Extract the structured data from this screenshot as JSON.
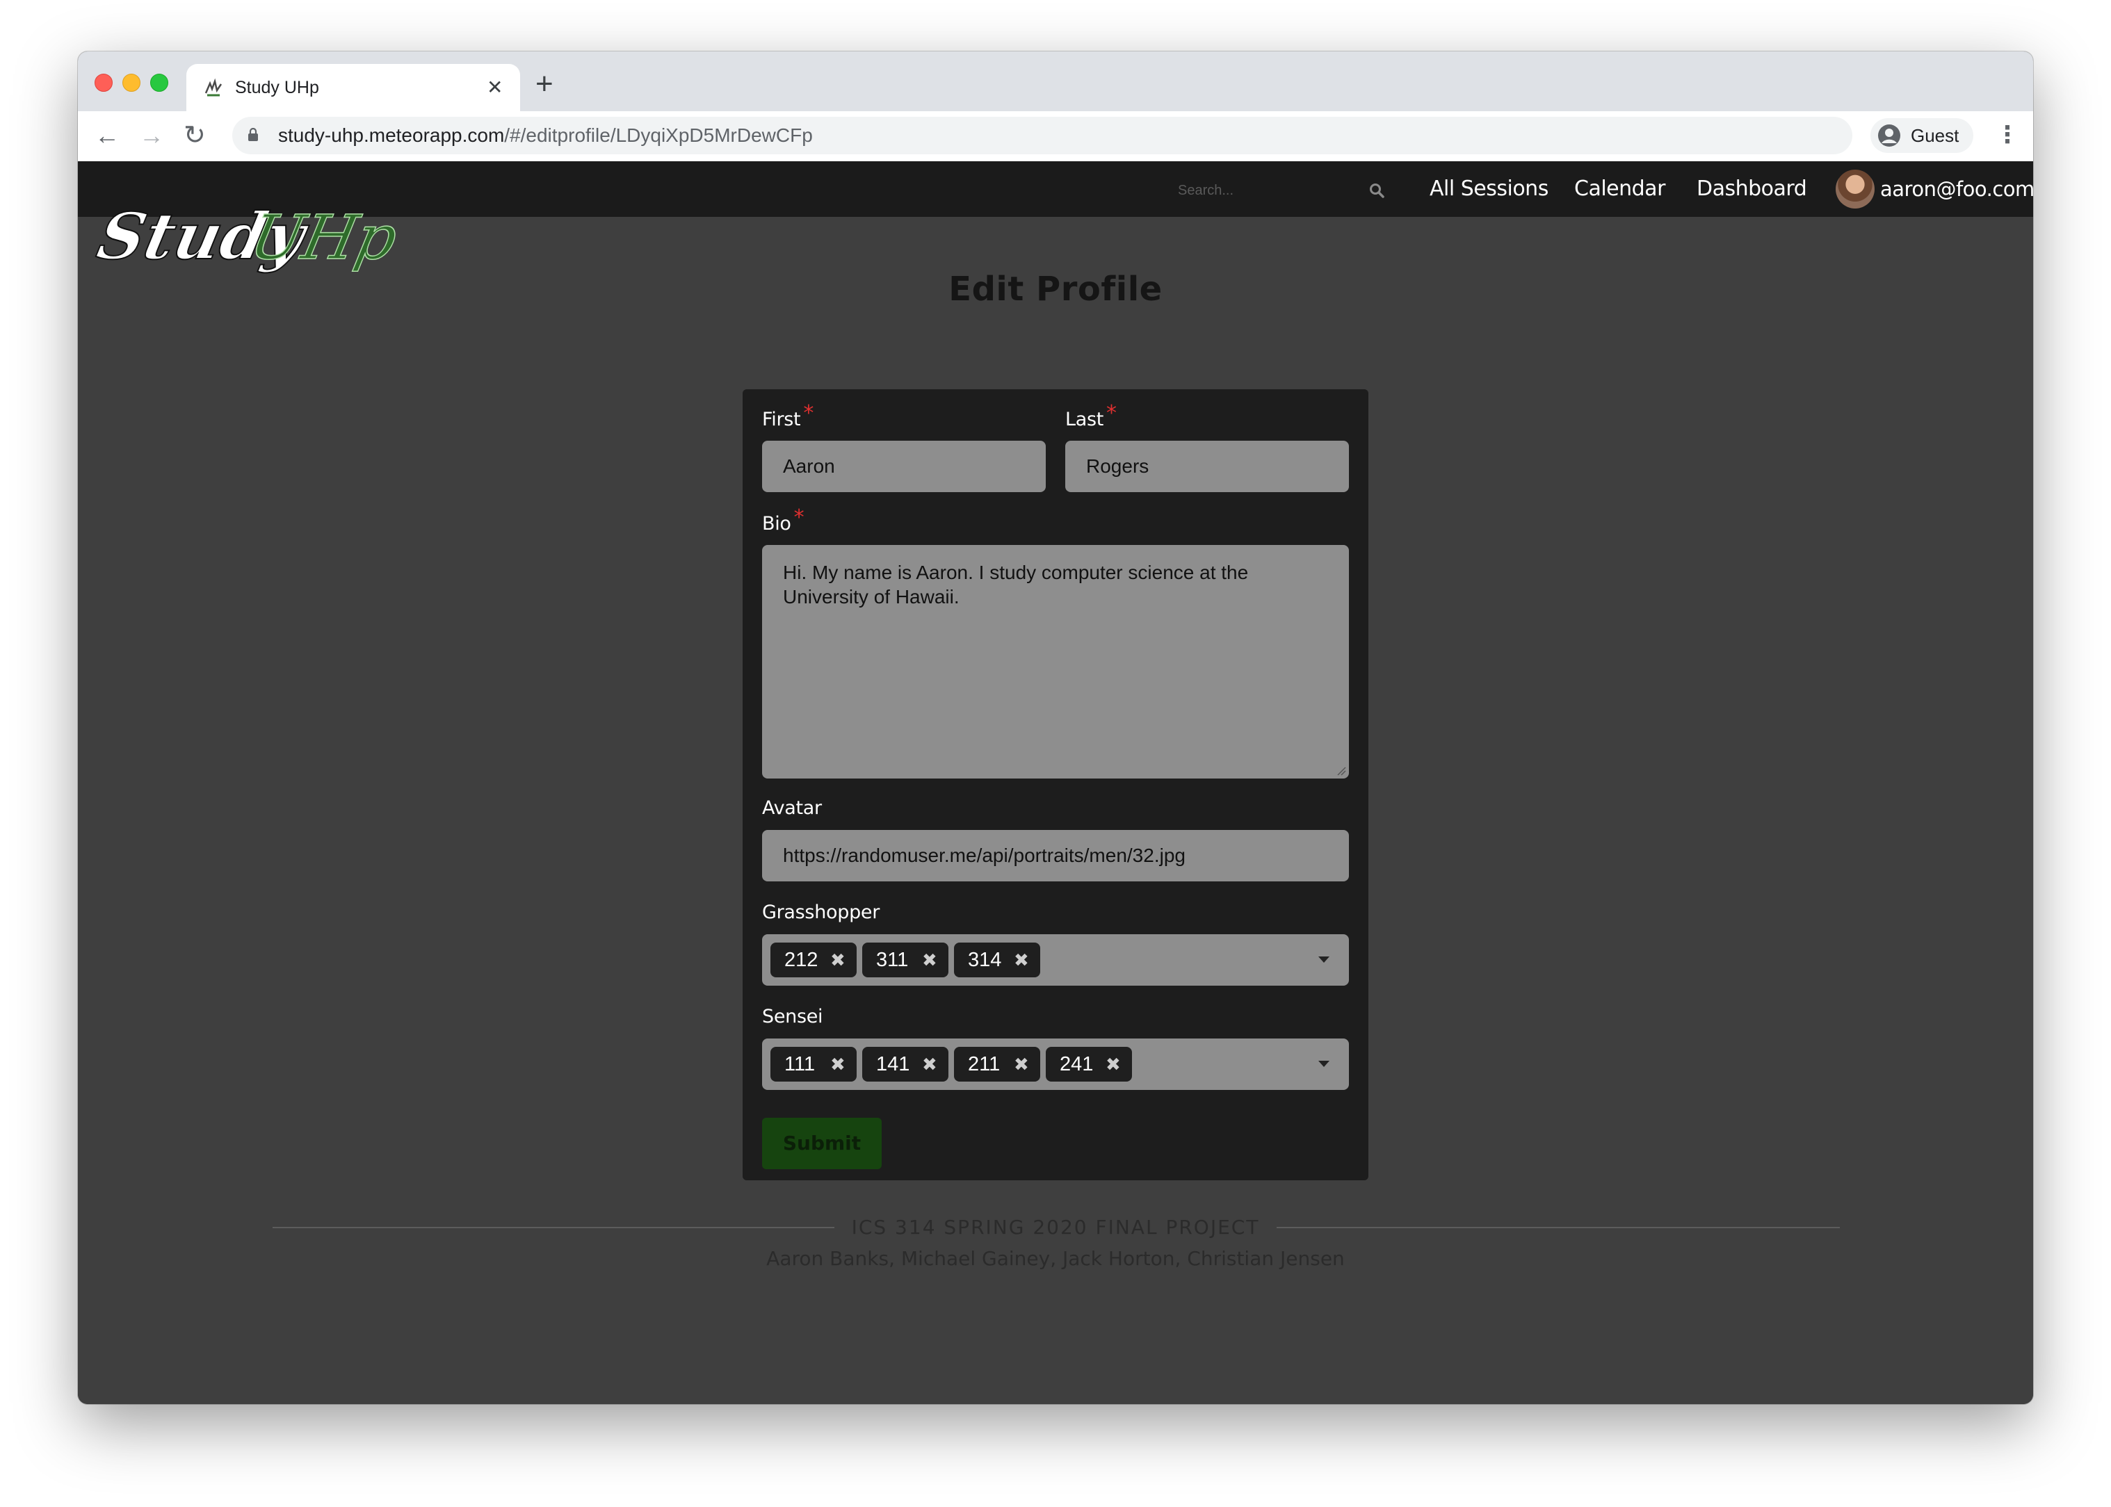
{
  "browser": {
    "tab_title": "Study UHp",
    "url_host": "study-uhp.meteorapp.com",
    "url_path": "/#/editprofile/LDyqiXpD5MrDewCFp",
    "profile_name": "Guest"
  },
  "navbar": {
    "logo_text_1": "Study",
    "logo_text_2": "UHp",
    "search_placeholder": "Search...",
    "links": [
      "All Sessions",
      "Calendar",
      "Dashboard"
    ],
    "user_email": "aaron@foo.com"
  },
  "form": {
    "title": "Edit Profile",
    "first_label": "First",
    "first_value": "Aaron",
    "last_label": "Last",
    "last_value": "Rogers",
    "bio_label": "Bio",
    "bio_value": "Hi. My name is Aaron. I study computer science at the University of Hawaii.",
    "avatar_label": "Avatar",
    "avatar_value": "https://randomuser.me/api/portraits/men/32.jpg",
    "required_mark": "*",
    "grasshopper_label": "Grasshopper",
    "grasshopper_courses": [
      "212",
      "311",
      "314"
    ],
    "sensei_label": "Sensei",
    "sensei_courses": [
      "111",
      "141",
      "211",
      "241"
    ],
    "submit_label": "Submit"
  },
  "footer": {
    "title": "ICS 314 SPRING 2020 FINAL PROJECT",
    "authors": "Aaron Banks, Michael Gainey, Jack Horton, Christian Jensen"
  },
  "colors": {
    "navbar_bg": "#1b1b1b",
    "page_bg": "#3f3f3f",
    "card_bg": "#1d1d1d",
    "field_bg": "#8e8e8e",
    "accent_green": "#2e6b2a",
    "submit_bg": "#16440f",
    "required_red": "#e03030"
  },
  "icons": [
    "close-icon",
    "plus-icon",
    "back-arrow-icon",
    "forward-arrow-icon",
    "reload-icon",
    "lock-icon",
    "account-icon",
    "kebab-menu-icon",
    "search-icon",
    "remove-chip-icon",
    "dropdown-caret-icon"
  ]
}
